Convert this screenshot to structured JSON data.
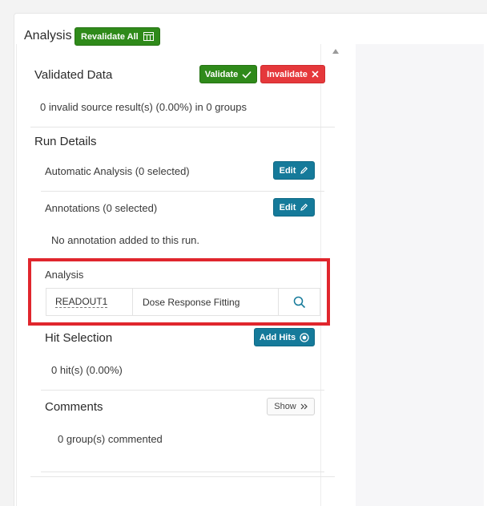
{
  "header": {
    "title": "Analysis",
    "revalidate_label": "Revalidate All"
  },
  "validated_data": {
    "title": "Validated Data",
    "validate_label": "Validate",
    "invalidate_label": "Invalidate",
    "summary": "0 invalid source result(s) (0.00%) in 0 groups"
  },
  "run_details": {
    "title": "Run Details",
    "automatic_analysis": "Automatic Analysis (0 selected)",
    "annotations": "Annotations (0 selected)",
    "edit_label": "Edit",
    "no_annotation": "No annotation added to this run."
  },
  "analysis": {
    "label": "Analysis",
    "readout": "READOUT1",
    "method": "Dose Response Fitting"
  },
  "hit_selection": {
    "title": "Hit Selection",
    "add_hits_label": "Add Hits",
    "summary": "0 hit(s) (0.00%)"
  },
  "comments": {
    "title": "Comments",
    "show_label": "Show",
    "summary": "0 group(s) commented"
  },
  "colors": {
    "green": "#2f8a1a",
    "red": "#e5383b",
    "teal": "#157a9a",
    "highlight": "#e0262d"
  }
}
